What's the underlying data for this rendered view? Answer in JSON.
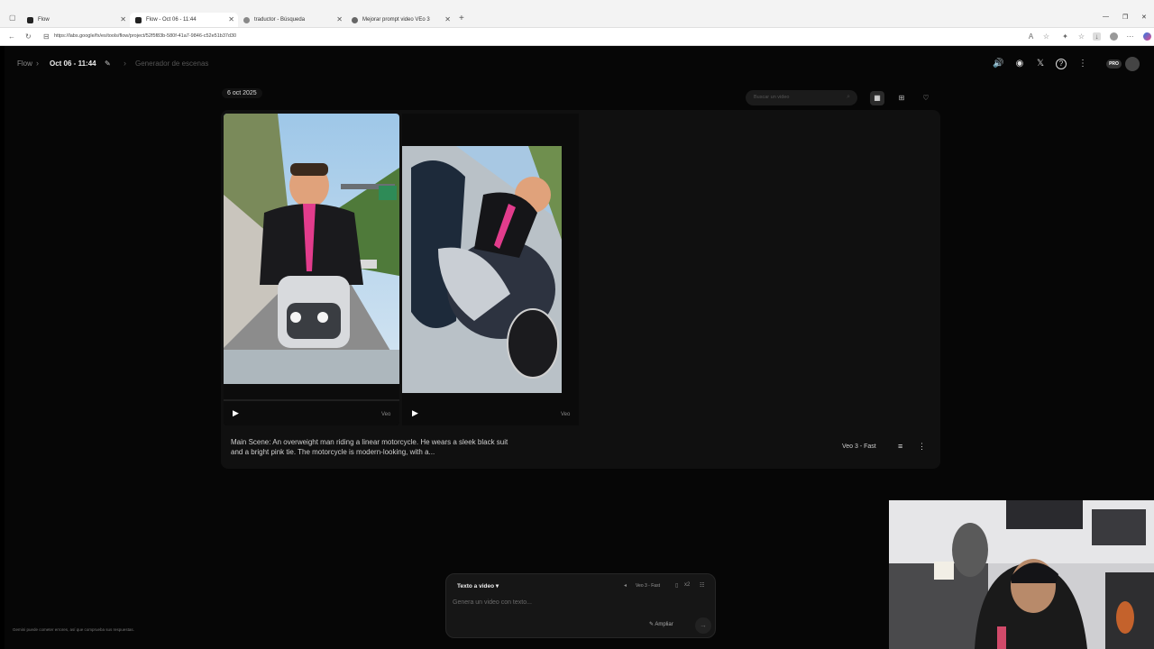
{
  "browser": {
    "tabs": [
      {
        "title": "Flow",
        "active": false
      },
      {
        "title": "Flow - Oct 06 - 11:44",
        "active": true
      },
      {
        "title": "traductor - Búsqueda",
        "active": false
      },
      {
        "title": "Mejorar prompt video VEo 3",
        "active": false
      }
    ],
    "new_tab": "+",
    "url": "https://labs.google/fx/es/tools/flow/project/52f5f83b-580f-41a7-9846-c52e51b37d30"
  },
  "header": {
    "breadcrumb_root": "Flow",
    "project_title": "Oct 06 - 11:44",
    "section": "Generador de escenas",
    "pro_badge": "PRO"
  },
  "toolbar": {
    "date_label": "6 oct 2025",
    "search_placeholder": "Buscar un video"
  },
  "generation": {
    "prompt": "Main Scene: An overweight man riding a linear motorcycle. He wears a sleek black suit and a bright pink tie. The motorcycle is modern-looking, with a...",
    "model": "Veo 3 - Fast",
    "videos": [
      {
        "badge": "Veo"
      },
      {
        "badge": "Veo"
      }
    ]
  },
  "composer": {
    "mode": "Texto a video",
    "model": "Veo 3 - Fast",
    "count": "x2",
    "placeholder": "Genera un video con texto...",
    "expand_label": "Ampliar"
  },
  "footer": {
    "disclaimer": "Gemini puede cometer errores, así que comprueba sus respuestas."
  }
}
